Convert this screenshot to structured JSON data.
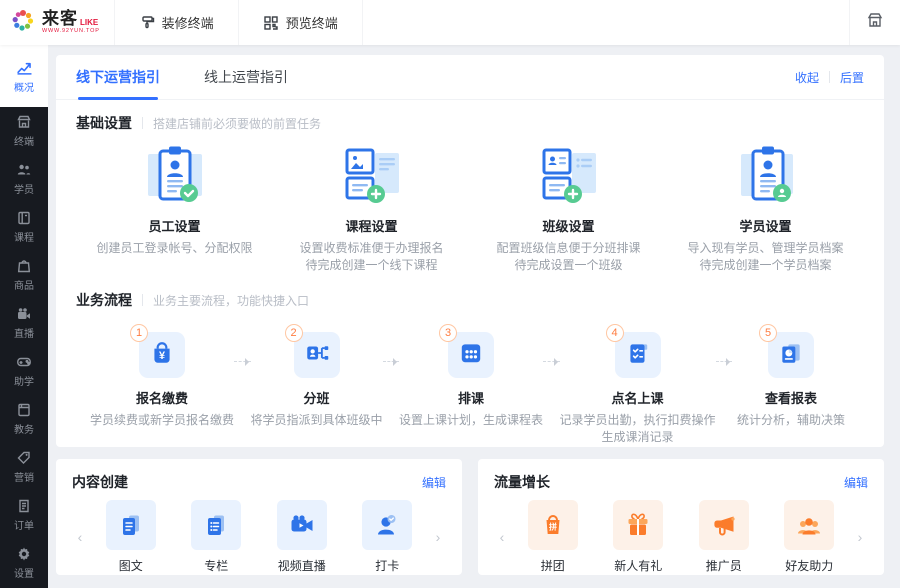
{
  "header": {
    "logo": {
      "brand": "来客",
      "suffix": "LIKE",
      "subtitle": "WWW.92YUN.TOP"
    },
    "nav": [
      {
        "label": "装修终端"
      },
      {
        "label": "预览终端"
      }
    ]
  },
  "sidebar": {
    "items": [
      {
        "label": "概况",
        "active": true
      },
      {
        "label": "终端"
      },
      {
        "label": "学员"
      },
      {
        "label": "课程"
      },
      {
        "label": "商品"
      },
      {
        "label": "直播"
      },
      {
        "label": "助学"
      },
      {
        "label": "教务"
      },
      {
        "label": "营销"
      },
      {
        "label": "订单"
      },
      {
        "label": "设置"
      }
    ]
  },
  "guide": {
    "tabs": [
      {
        "label": "线下运营指引",
        "active": true
      },
      {
        "label": "线上运营指引",
        "active": false
      }
    ],
    "actions": {
      "collapse": "收起",
      "move_back": "后置"
    },
    "basic": {
      "title": "基础设置",
      "subtitle": "搭建店铺前必须要做的前置任务",
      "cards": [
        {
          "title": "员工设置",
          "desc1": "创建员工登录帐号、分配权限",
          "desc2": ""
        },
        {
          "title": "课程设置",
          "desc1": "设置收费标准便于办理报名",
          "desc2": "待完成创建一个线下课程"
        },
        {
          "title": "班级设置",
          "desc1": "配置班级信息便于分班排课",
          "desc2": "待完成设置一个班级"
        },
        {
          "title": "学员设置",
          "desc1": "导入现有学员、管理学员档案",
          "desc2": "待完成创建一个学员档案"
        }
      ]
    },
    "process": {
      "title": "业务流程",
      "subtitle": "业务主要流程，功能快捷入口",
      "steps": [
        {
          "num": "1",
          "title": "报名缴费",
          "desc1": "学员续费或新学员报名缴费",
          "desc2": ""
        },
        {
          "num": "2",
          "title": "分班",
          "desc1": "将学员指派到具体班级中",
          "desc2": ""
        },
        {
          "num": "3",
          "title": "排课",
          "desc1": "设置上课计划，生成课程表",
          "desc2": ""
        },
        {
          "num": "4",
          "title": "点名上课",
          "desc1": "记录学员出勤，执行扣费操作",
          "desc2": "生成课消记录"
        },
        {
          "num": "5",
          "title": "查看报表",
          "desc1": "统计分析，辅助决策",
          "desc2": ""
        }
      ]
    }
  },
  "panels": [
    {
      "title": "内容创建",
      "edit_label": "编辑",
      "items": [
        {
          "label": "图文"
        },
        {
          "label": "专栏"
        },
        {
          "label": "视频直播"
        },
        {
          "label": "打卡"
        }
      ]
    },
    {
      "title": "流量增长",
      "edit_label": "编辑",
      "items": [
        {
          "label": "拼团"
        },
        {
          "label": "新人有礼"
        },
        {
          "label": "推广员"
        },
        {
          "label": "好友助力"
        }
      ]
    }
  ],
  "colors": {
    "accent_blue": "#3370ff",
    "icon_blue": "#2e74e8",
    "brand_red": "#e3173c",
    "badge_orange": "#ff7d41",
    "icon_orange": "#fb7c2b",
    "success_green": "#57cb92",
    "sidebar_dark": "#171a20",
    "page_bg": "#eef0f4"
  }
}
